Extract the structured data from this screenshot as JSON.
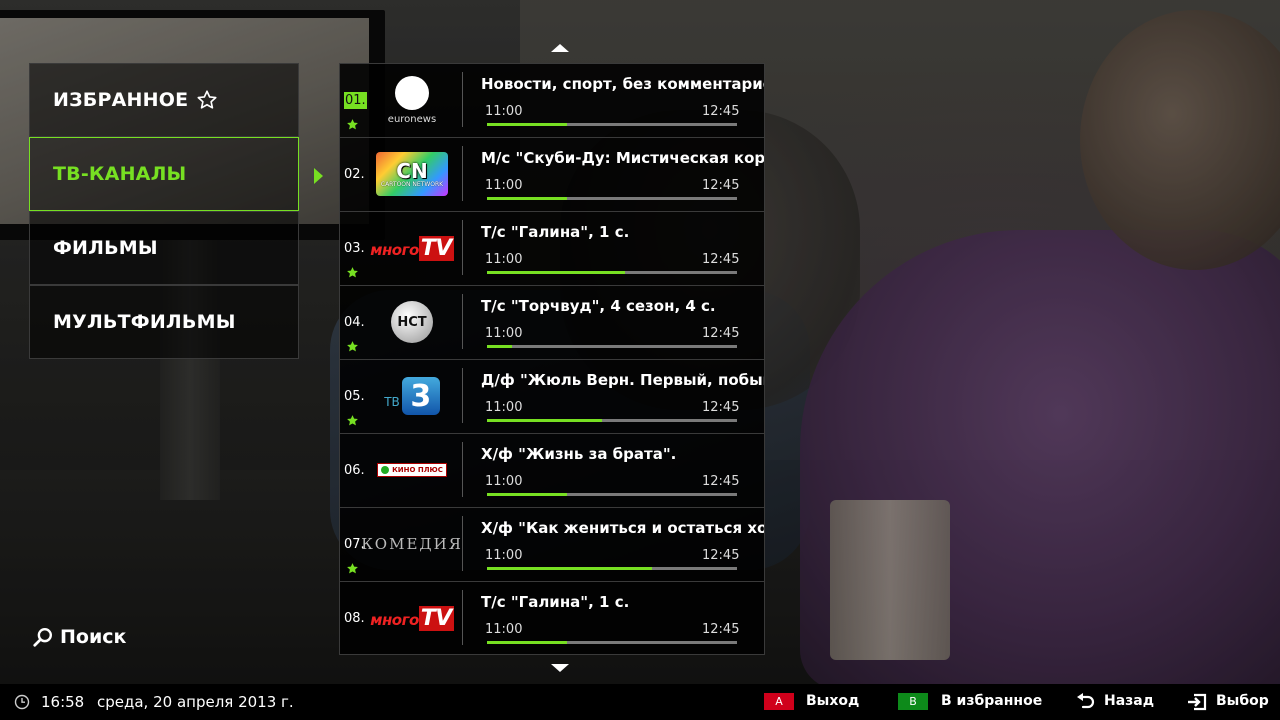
{
  "menu": {
    "items": [
      {
        "label": "ИЗБРАННОЕ",
        "icon": "star-outline-icon",
        "active": false
      },
      {
        "label": "ТВ-КАНАЛЫ",
        "active": true
      },
      {
        "label": "ФИЛЬМЫ",
        "active": false
      },
      {
        "label": "МУЛЬТФИЛЬМЫ",
        "active": false
      }
    ],
    "search_label": "Поиск"
  },
  "channels": [
    {
      "num": "01.",
      "logo": "euronews",
      "logo_text": "euronews",
      "favorite": true,
      "selected": true,
      "program": "Новости, спорт, без комментариев",
      "start": "11:00",
      "end": "12:45",
      "progress": 0.32
    },
    {
      "num": "02.",
      "logo": "cartoon-network",
      "logo_text": "CN",
      "logo_subtext": "CARTOON NETWORK",
      "favorite": false,
      "program": "М/с \"Скуби-Ду: Мистическая корпорация\"",
      "start": "11:00",
      "end": "12:45",
      "progress": 0.32
    },
    {
      "num": "03.",
      "logo": "mnogo-tv",
      "logo_text": "много",
      "logo_tv": "TV",
      "favorite": true,
      "program": "Т/с \"Галина\", 1 с.",
      "start": "11:00",
      "end": "12:45",
      "progress": 0.55
    },
    {
      "num": "04.",
      "logo": "nst",
      "logo_text": "НСТ",
      "favorite": true,
      "program": "Т/с \"Торчвуд\", 4 сезон, 4 с.",
      "start": "11:00",
      "end": "12:45",
      "progress": 0.1
    },
    {
      "num": "05.",
      "logo": "tv3",
      "logo_text": "ТВ",
      "logo_digit": "3",
      "favorite": true,
      "program": "Д/ф \"Жюль Верн. Первый, побывавший на Луне\"",
      "start": "11:00",
      "end": "12:45",
      "progress": 0.46
    },
    {
      "num": "06.",
      "logo": "kino-plus",
      "logo_text": "КИНО ПЛЮС",
      "favorite": false,
      "program": "Х/ф \"Жизнь за брата\".",
      "start": "11:00",
      "end": "12:45",
      "progress": 0.32
    },
    {
      "num": "07.",
      "logo": "komediya",
      "logo_text": "КОМЕДИЯ",
      "favorite": true,
      "program": "Х/ф \"Как жениться и остаться холостым\"",
      "start": "11:00",
      "end": "12:45",
      "progress": 0.66
    },
    {
      "num": "08.",
      "logo": "mnogo-tv",
      "logo_text": "много",
      "logo_tv": "TV",
      "favorite": false,
      "program": "Т/с \"Галина\", 1 с.",
      "start": "11:00",
      "end": "12:45",
      "progress": 0.32
    }
  ],
  "status": {
    "time": "16:58",
    "date": "среда,  20 апреля 2013 г."
  },
  "keys": {
    "red_key": "A",
    "red_label": "Выход",
    "green_key": "B",
    "green_label": "В избранное",
    "back_label": "Назад",
    "select_label": "Выбор"
  },
  "colors": {
    "accent": "#77e022",
    "red_key": "#d0001b",
    "green_key": "#0d8a1a"
  }
}
